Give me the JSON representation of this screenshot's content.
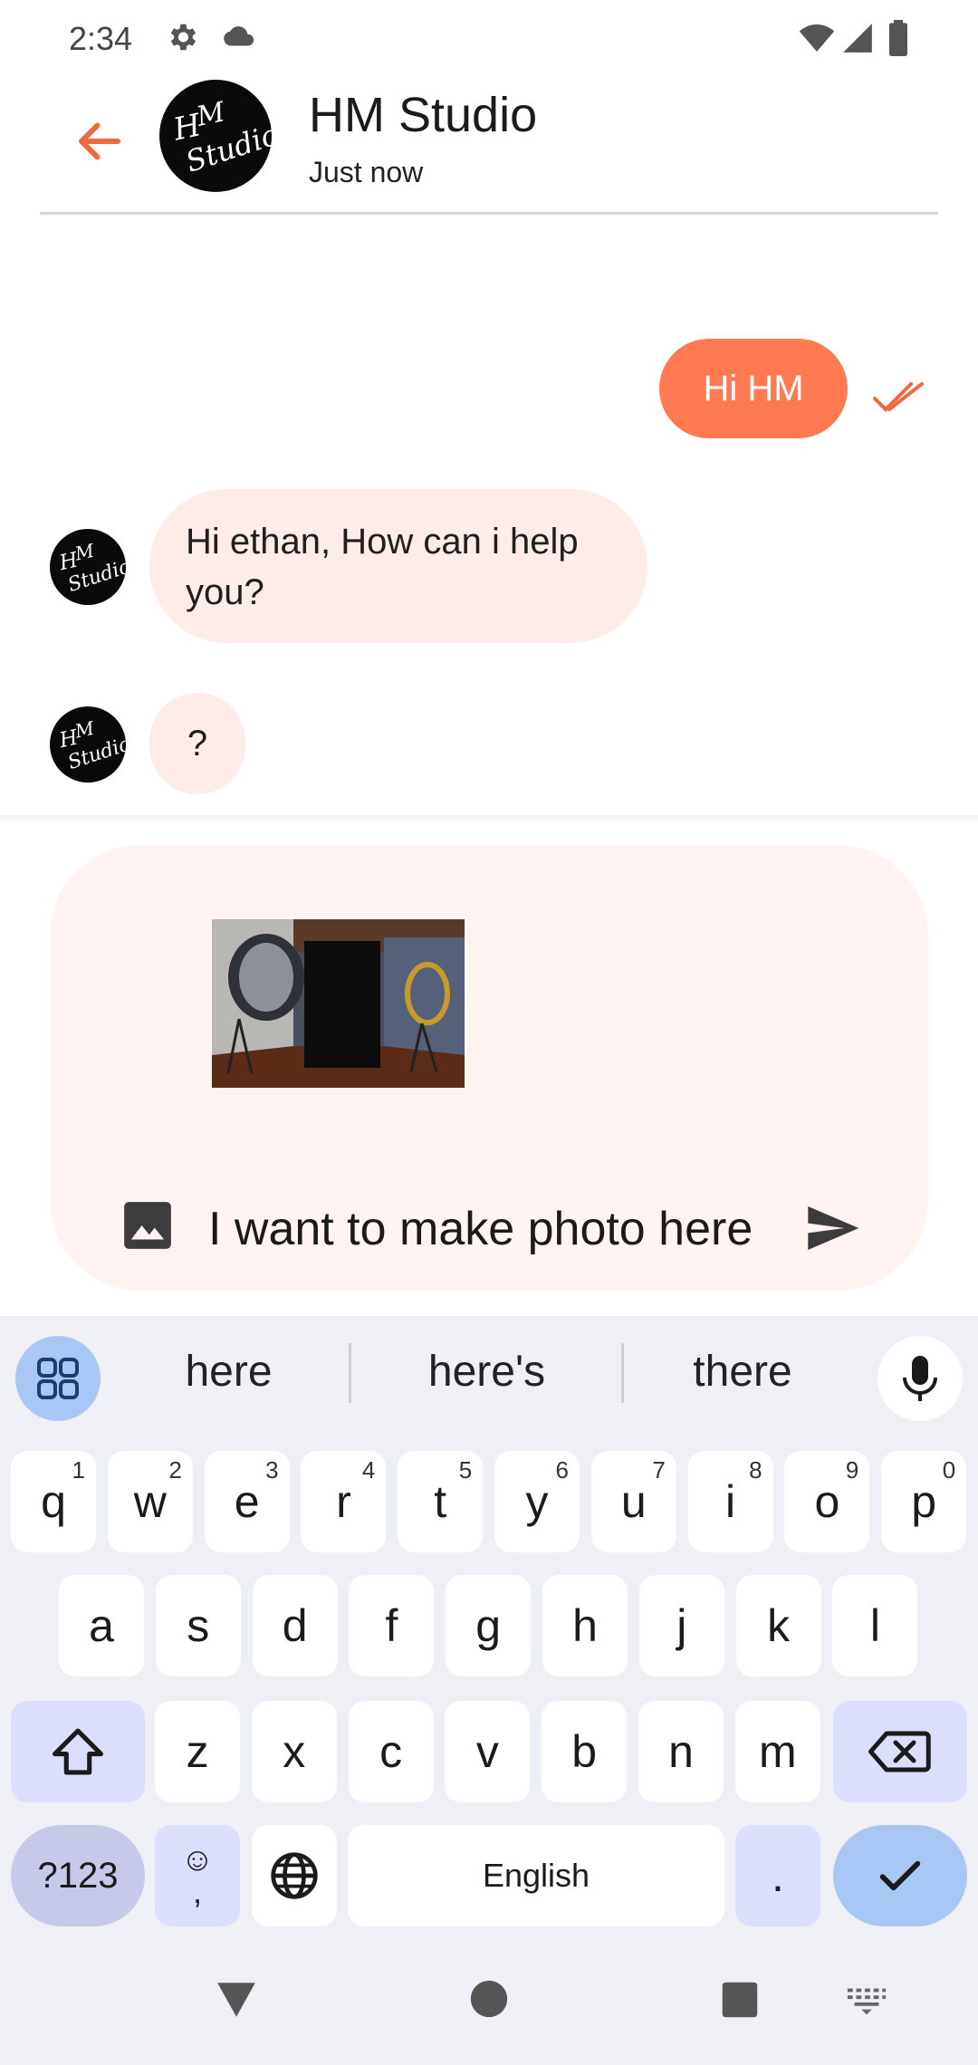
{
  "status_bar": {
    "time": "2:34",
    "icons": [
      "settings-icon",
      "cloud-icon",
      "wifi-icon",
      "signal-icon",
      "battery-icon"
    ]
  },
  "header": {
    "title": "HM Studio",
    "subtitle": "Just now",
    "avatar_text": "HM Studio"
  },
  "messages": [
    {
      "side": "outgoing",
      "text": "Hi HM",
      "status": "read"
    },
    {
      "side": "incoming",
      "text": "Hi ethan, How can i help you?"
    },
    {
      "side": "incoming",
      "text": "?"
    }
  ],
  "composer": {
    "text": "I want to make photo here",
    "attachment": "photo-studio-image"
  },
  "keyboard": {
    "suggestions": [
      "here",
      "here's",
      "there"
    ],
    "row1": [
      {
        "k": "q",
        "h": "1"
      },
      {
        "k": "w",
        "h": "2"
      },
      {
        "k": "e",
        "h": "3"
      },
      {
        "k": "r",
        "h": "4"
      },
      {
        "k": "t",
        "h": "5"
      },
      {
        "k": "y",
        "h": "6"
      },
      {
        "k": "u",
        "h": "7"
      },
      {
        "k": "i",
        "h": "8"
      },
      {
        "k": "o",
        "h": "9"
      },
      {
        "k": "p",
        "h": "0"
      }
    ],
    "row2": [
      "a",
      "s",
      "d",
      "f",
      "g",
      "h",
      "j",
      "k",
      "l"
    ],
    "row3": [
      "z",
      "x",
      "c",
      "v",
      "b",
      "n",
      "m"
    ],
    "symbols_label": "?123",
    "emoji_label": "☺",
    "comma_label": ",",
    "space_label": "English",
    "period_label": "."
  },
  "colors": {
    "accent": "#ff7a50",
    "incoming_bubble": "#fdece8",
    "composer_bg": "#fff4f1",
    "keyboard_bg": "#eef0f6",
    "mod_key": "#dcdffb",
    "action_key": "#a8c7f5"
  }
}
